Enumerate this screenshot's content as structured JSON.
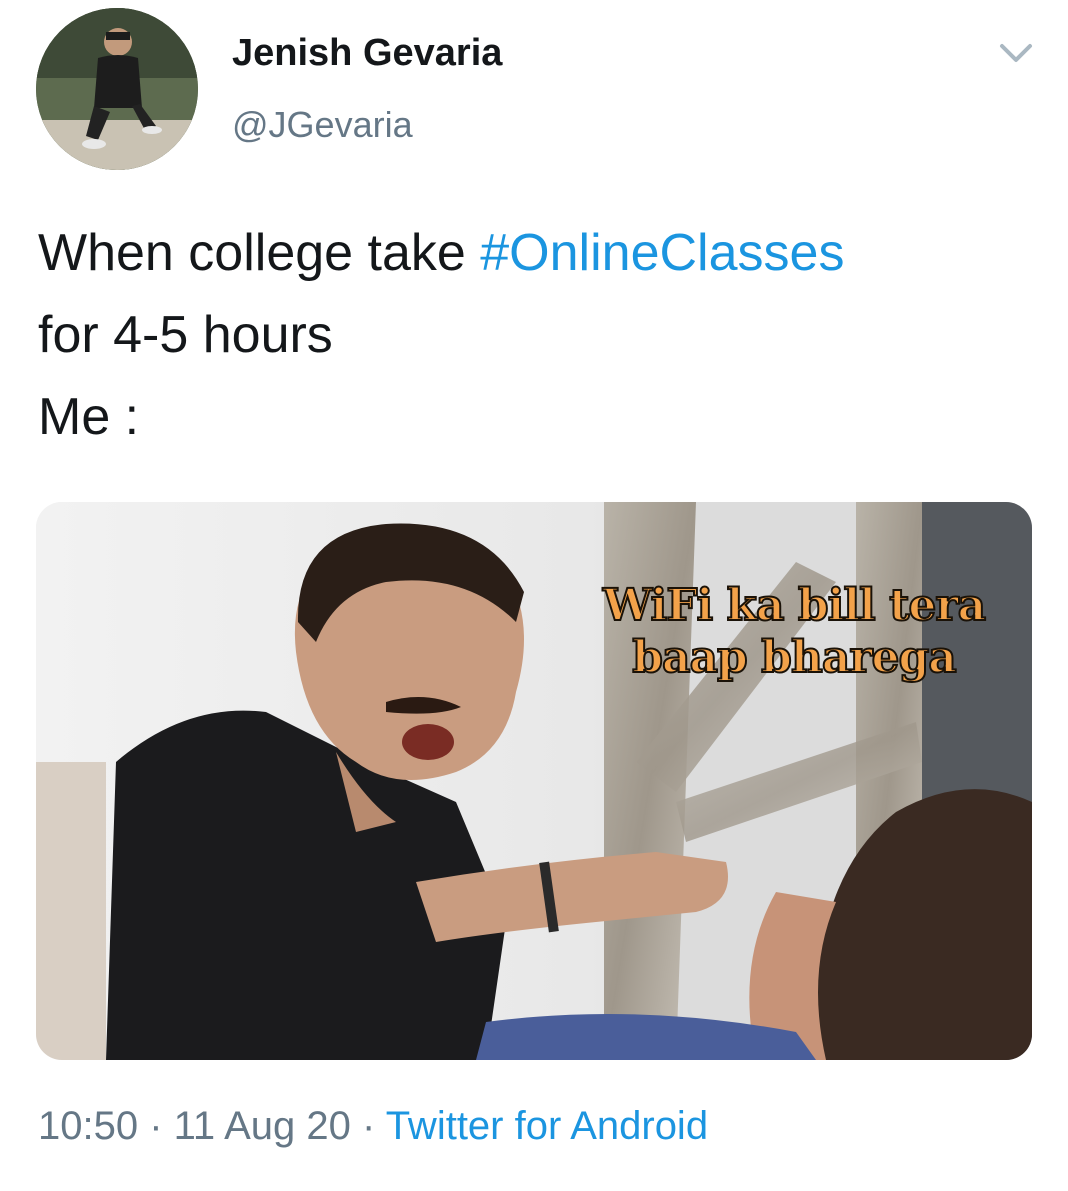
{
  "user": {
    "display_name": "Jenish Gevaria",
    "handle": "@JGevaria",
    "avatar_icon": "profile-photo"
  },
  "tweet": {
    "text_line1_prefix": "When college take ",
    "hashtag": "#OnlineClasses",
    "text_line2": "for 4-5 hours",
    "text_line3": "Me :"
  },
  "media": {
    "caption_line1": "WiFi ka bill tera",
    "caption_line2": "baap bharega"
  },
  "meta": {
    "time": "10:50",
    "separator1": " · ",
    "date": "11 Aug 20",
    "separator2": " · ",
    "source": "Twitter for Android"
  },
  "colors": {
    "link": "#1b95e0",
    "secondary_text": "#657786",
    "caption_fill": "#f3a24a"
  },
  "icons": {
    "menu": "chevron-down-icon"
  }
}
